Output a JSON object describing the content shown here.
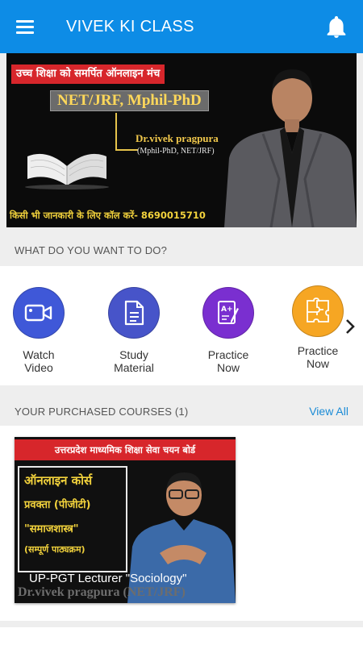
{
  "appbar": {
    "title": "VIVEK KI CLASS"
  },
  "banner": {
    "heading": "उच्च शिक्षा को समर्पित ऑनलाइन मंच",
    "courses": "NET/JRF, Mphil-PhD",
    "name": "Dr.vivek pragpura",
    "degrees": "(Mphil-PhD, NET/JRF)",
    "contact": "किसी भी जानकारी के लिए कॉल करें- 8690015710"
  },
  "quick_actions": {
    "heading": "WHAT DO YOU WANT TO DO?",
    "items": [
      {
        "line1": "Watch",
        "line2": "Video",
        "icon": "video-camera-icon",
        "color": "#3f58d8"
      },
      {
        "line1": "Study",
        "line2": "Material",
        "icon": "document-icon",
        "color": "#4754c9"
      },
      {
        "line1": "Practice",
        "line2": "Now",
        "icon": "a-plus-exam-icon",
        "color": "#7a2fd0"
      },
      {
        "line1": "Practice",
        "line2": "Now",
        "icon": "puzzle-icon",
        "color": "#f6a623"
      }
    ]
  },
  "purchased": {
    "heading": "YOUR PURCHASED COURSES (1)",
    "view_all": "View All",
    "course": {
      "banner_title": "उत्तरप्रदेश माध्यमिक शिक्षा सेवा चयन बोर्ड",
      "line1": "ऑनलाइन कोर्स",
      "line2": "प्रवक्ता (पीजीटी)",
      "line3": "\"समाजशास्त्र\"",
      "line4": "(सम्पूर्ण पाठ्यक्रम)",
      "caption": "UP-PGT Lecturer \"Sociology\"",
      "footer": "Dr.vivek pragpura (NET/JRF)"
    }
  }
}
